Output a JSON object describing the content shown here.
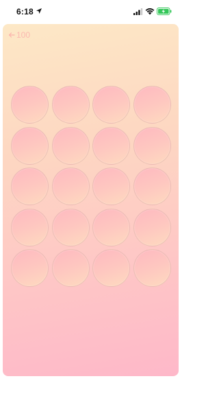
{
  "status_bar": {
    "time": "6:18",
    "icons": [
      "location-arrow-icon",
      "cellular-signal-icon",
      "wifi-icon",
      "battery-charging-icon"
    ],
    "battery_color": "#34c759"
  },
  "card": {
    "back_label": "100",
    "back_icon": "left-arrow-icon",
    "gradient_top": "#fde8c6",
    "gradient_bottom": "#feb8c9"
  },
  "grid": {
    "rows": 5,
    "columns": 4,
    "cells": [
      {
        "row": 1,
        "col": 1
      },
      {
        "row": 1,
        "col": 2
      },
      {
        "row": 1,
        "col": 3
      },
      {
        "row": 1,
        "col": 4
      },
      {
        "row": 2,
        "col": 1
      },
      {
        "row": 2,
        "col": 2
      },
      {
        "row": 2,
        "col": 3
      },
      {
        "row": 2,
        "col": 4
      },
      {
        "row": 3,
        "col": 1
      },
      {
        "row": 3,
        "col": 2
      },
      {
        "row": 3,
        "col": 3
      },
      {
        "row": 3,
        "col": 4
      },
      {
        "row": 4,
        "col": 1
      },
      {
        "row": 4,
        "col": 2
      },
      {
        "row": 4,
        "col": 3
      },
      {
        "row": 4,
        "col": 4
      },
      {
        "row": 5,
        "col": 1
      },
      {
        "row": 5,
        "col": 2
      },
      {
        "row": 5,
        "col": 3
      },
      {
        "row": 5,
        "col": 4
      }
    ]
  }
}
